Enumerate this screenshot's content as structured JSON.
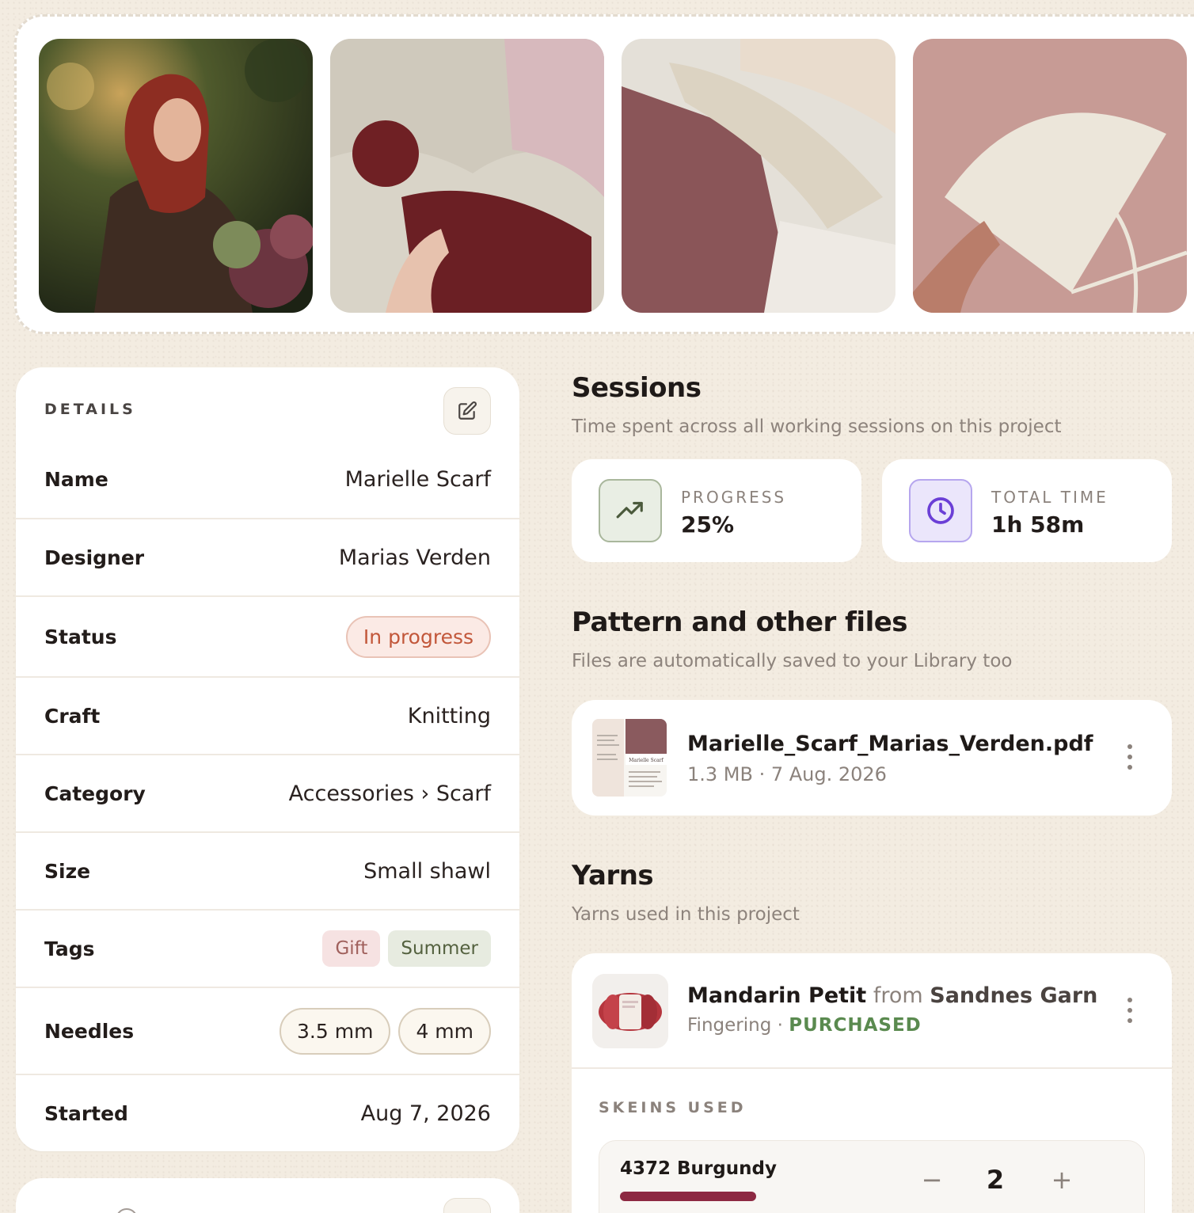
{
  "gallery": {
    "photos": [
      {
        "alt": "photo-1"
      },
      {
        "alt": "photo-2"
      },
      {
        "alt": "photo-3"
      },
      {
        "alt": "photo-4"
      }
    ]
  },
  "details": {
    "heading": "DETAILS",
    "name_label": "Name",
    "name_value": "Marielle Scarf",
    "designer_label": "Designer",
    "designer_value": "Marias Verden",
    "status_label": "Status",
    "status_value": "In progress",
    "craft_label": "Craft",
    "craft_value": "Knitting",
    "category_label": "Category",
    "category_value": "Accessories › Scarf",
    "size_label": "Size",
    "size_value": "Small shawl",
    "tags_label": "Tags",
    "tags": [
      "Gift",
      "Summer"
    ],
    "needles_label": "Needles",
    "needles": [
      "3.5 mm",
      "4 mm"
    ],
    "started_label": "Started",
    "started_value": "Aug 7, 2026"
  },
  "sessions": {
    "title": "Sessions",
    "subtitle": "Time spent across all working sessions on this project",
    "progress_label": "PROGRESS",
    "progress_value": "25%",
    "time_label": "TOTAL TIME",
    "time_value": "1h 58m"
  },
  "files": {
    "title": "Pattern and other files",
    "subtitle": "Files are automatically saved to your Library too",
    "items": [
      {
        "name": "Marielle_Scarf_Marias_Verden.pdf",
        "meta": "1.3 MB · 7 Aug. 2026",
        "thumb_caption": "Marielle Scarf"
      }
    ]
  },
  "yarns": {
    "title": "Yarns",
    "subtitle": "Yarns used in this project",
    "items": [
      {
        "name": "Mandarin Petit",
        "from": "from",
        "brand": "Sandnes Garn",
        "weight": "Fingering",
        "separator": " · ",
        "status": "PURCHASED",
        "skeins_label": "SKEINS USED",
        "colorway": "4372 Burgundy",
        "colorway_color": "#8d2942",
        "skeins": "2",
        "minus": "−",
        "plus": "+"
      }
    ]
  },
  "colors": {
    "background": "#f3ece1",
    "status_accent": "#c2573a",
    "purchased": "#5a8a4f",
    "time_icon": "#6b3fd6"
  },
  "icons": {
    "edit": "edit-icon",
    "progress": "trending-up-icon",
    "time": "clock-icon",
    "more": "more-vertical-icon"
  }
}
